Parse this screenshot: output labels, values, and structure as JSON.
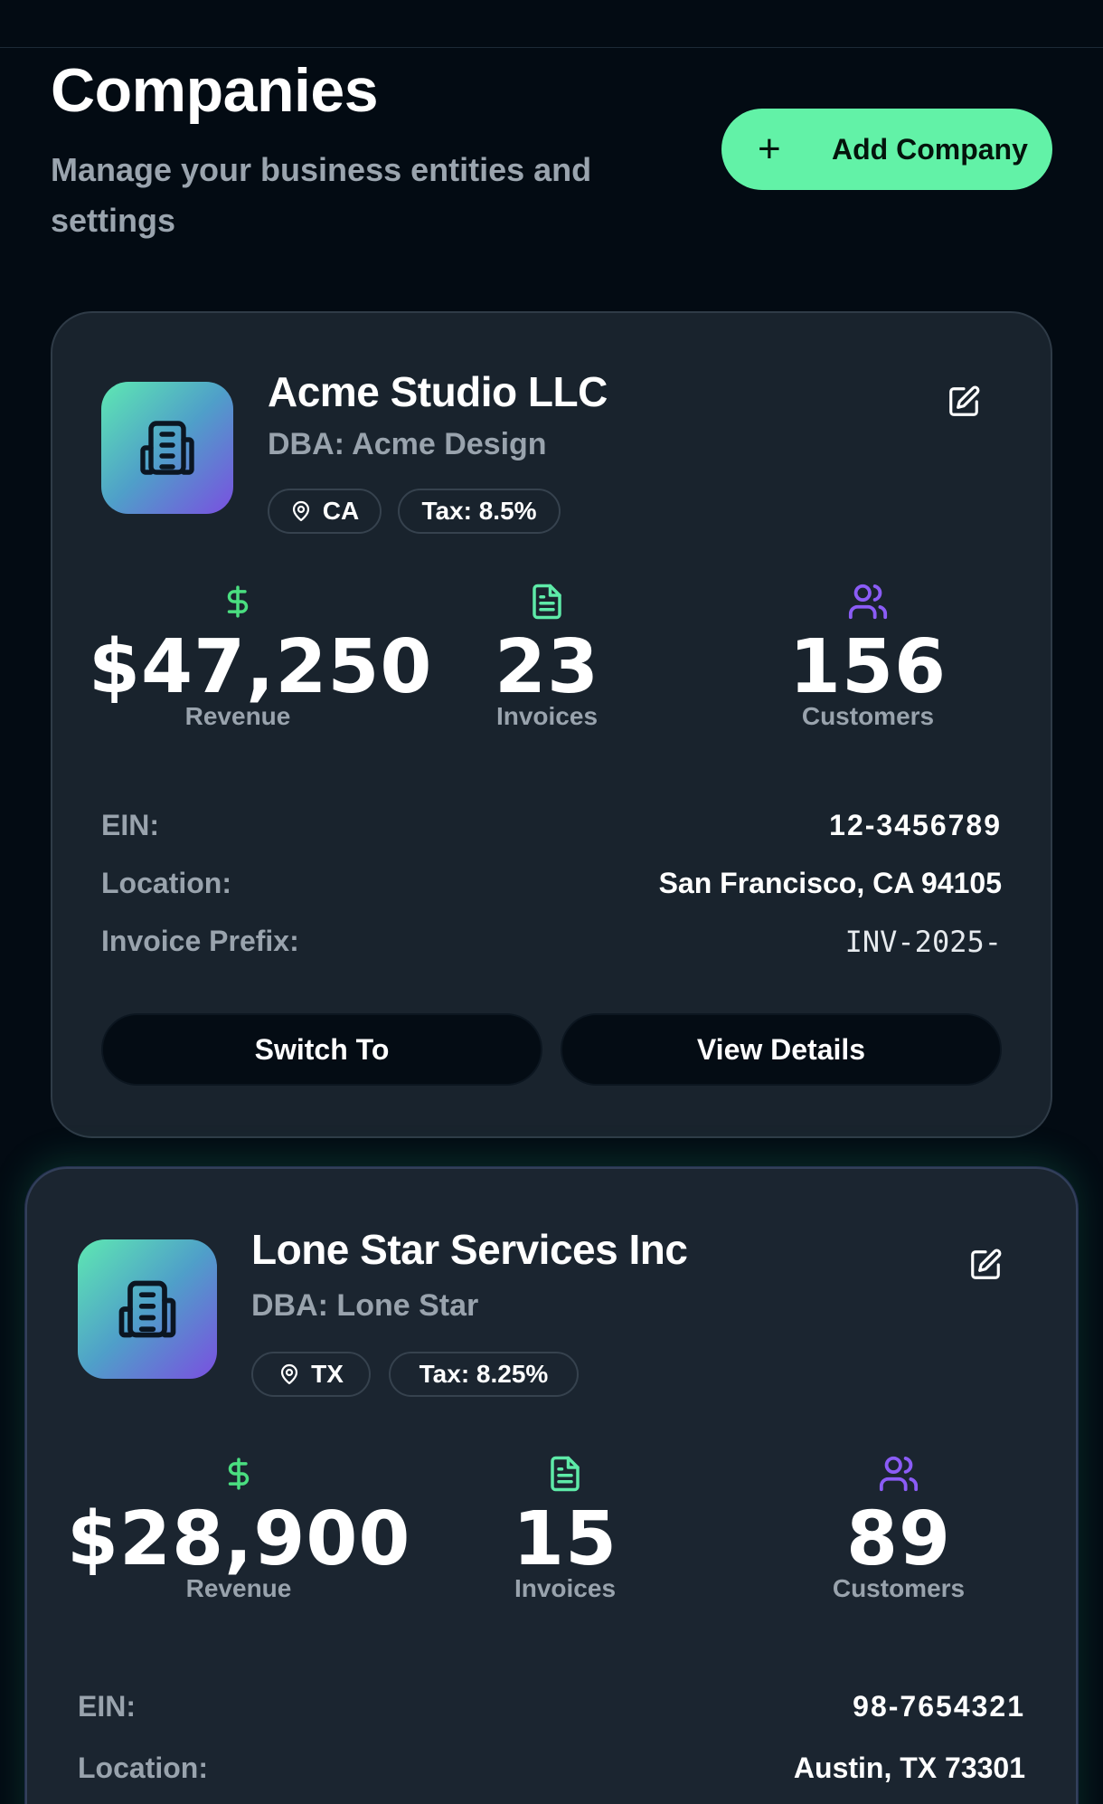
{
  "header": {
    "title": "Companies",
    "subtitle": "Manage your business entities and settings",
    "add_button": "Add Company"
  },
  "colors": {
    "accent": "#62f2a7",
    "revenue_icon": "#4ade80",
    "invoice_icon": "#5eeaa8",
    "customer_icon": "#8b5cf6"
  },
  "companies": [
    {
      "name": "Acme Studio LLC",
      "dba": "DBA: Acme Design",
      "state": "CA",
      "tax": "Tax: 8.5%",
      "revenue": "$47,250",
      "revenue_label": "Revenue",
      "invoices": "23",
      "invoices_label": "Invoices",
      "customers": "156",
      "customers_label": "Customers",
      "ein_label": "EIN:",
      "ein": "12-3456789",
      "location_label": "Location:",
      "location": "San Francisco, CA 94105",
      "prefix_label": "Invoice Prefix:",
      "prefix": "INV-2025-",
      "switch_button": "Switch To",
      "details_button": "View Details"
    },
    {
      "name": "Lone Star Services Inc",
      "dba": "DBA: Lone Star",
      "state": "TX",
      "tax": "Tax: 8.25%",
      "revenue": "$28,900",
      "revenue_label": "Revenue",
      "invoices": "15",
      "invoices_label": "Invoices",
      "customers": "89",
      "customers_label": "Customers",
      "ein_label": "EIN:",
      "ein": "98-7654321",
      "location_label": "Location:",
      "location": "Austin, TX 73301"
    }
  ],
  "icons": {
    "logo": "building-icon",
    "edit": "edit-icon",
    "pin": "map-pin-icon",
    "revenue": "dollar-icon",
    "invoices": "document-icon",
    "customers": "users-icon",
    "add": "plus-icon"
  }
}
